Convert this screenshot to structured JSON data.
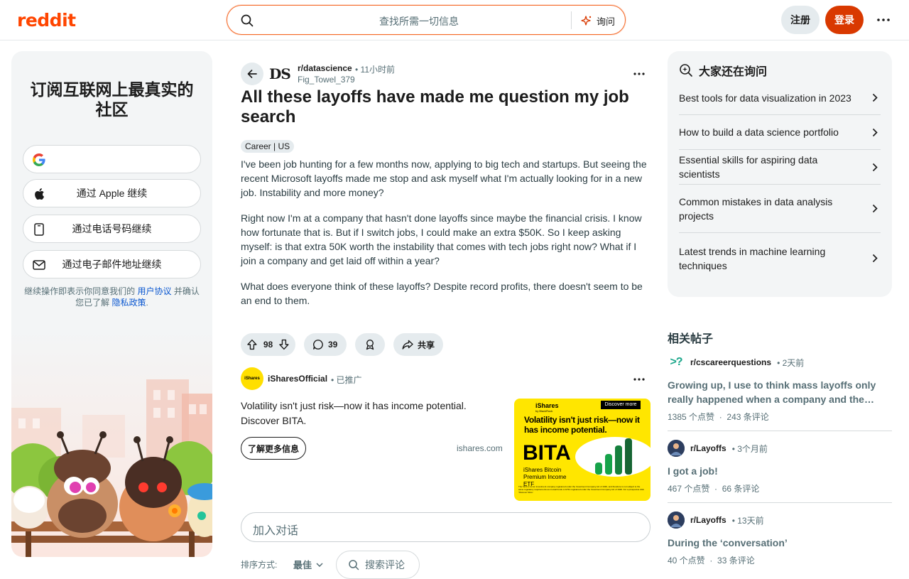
{
  "header": {
    "logo": "reddit",
    "search_placeholder": "查找所需一切信息",
    "ask_label": "询问",
    "signup_label": "注册",
    "login_label": "登录"
  },
  "left": {
    "title": "订阅互联网上最真实的社区",
    "auth_buttons": [
      {
        "label": "",
        "icon": "google-icon"
      },
      {
        "label": "通过 Apple 继续",
        "icon": "apple-icon"
      },
      {
        "label": "通过电话号码继续",
        "icon": "phone-icon"
      },
      {
        "label": "通过电子邮件地址继续",
        "icon": "mail-icon"
      }
    ],
    "terms_prefix": "继续操作即表示你同意我们的",
    "terms_link": "用户协议",
    "terms_mid": "并确认您已了解",
    "privacy_link": "隐私政策",
    "terms_suffix": "."
  },
  "post": {
    "subreddit_avatar": "DS",
    "subreddit": "r/datascience",
    "time": "11小时前",
    "author": "Fig_Towel_379",
    "title": "All these layoffs have made me question my job search",
    "flair": "Career | US",
    "paragraphs": [
      "I've been job hunting for a few months now, applying to big tech and startups. But seeing the recent Microsoft layoffs made me stop and ask myself what I'm actually looking for in a new job. Instability and more money?",
      "Right now I'm at a company that hasn't done layoffs since maybe the financial crisis. I know how fortunate that is. But if I switch jobs, I could make an extra $50K. So I keep asking myself: is that extra 50K worth the instability that comes with tech jobs right now? What if I join a company and get laid off within a year?",
      "What does everyone think of these layoffs? Despite record profits, there doesn't seem to be an end to them."
    ],
    "votes": "98",
    "comments": "39",
    "share_label": "共享"
  },
  "ad": {
    "avatar_text": "iShares",
    "name": "iSharesOfficial",
    "promoted": "已推广",
    "text": "Volatility isn't just risk—now it has income potential. Discover BITA.",
    "learn_more": "了解更多信息",
    "domain": "ishares.com",
    "image": {
      "brand": "iShares",
      "brand_sub": "by BlackRock",
      "cta": "Discover more",
      "headline": "Volatility isn't just risk—now it has income potential.",
      "ticker": "BITA",
      "fund_name": "iShares Bitcoin Premium Income ETF",
      "fineprint": "The fund is not an investment company registered under the Investment Company Act of 1940, and therefore is not subject to the same regulatory requirements as mutual funds or ETFs registered under the Investment Company Act of 1940. For a prospectus click 'Discover More'."
    }
  },
  "comments": {
    "placeholder": "加入对话",
    "sort_label": "排序方式:",
    "sort_value": "最佳",
    "search_label": "搜索评论"
  },
  "ask_card": {
    "title": "大家还在询问",
    "items": [
      "Best tools for data visualization in 2023",
      "How to build a data science portfolio",
      "Essential skills for aspiring data scientists",
      "Common mistakes in data analysis projects",
      "Latest trends in machine learning techniques"
    ]
  },
  "related": {
    "title": "相关帖子",
    "posts": [
      {
        "icon_text": ">?",
        "subreddit": "r/cscareerquestions",
        "time": "2天前",
        "title": "Growing up, I use to think mass layoffs only really happened when a company and the…",
        "upvotes": "1385 个点赞",
        "comments": "243 条评论"
      },
      {
        "icon_text": "",
        "subreddit": "r/Layoffs",
        "time": "3个月前",
        "title": "I got a job!",
        "upvotes": "467 个点赞",
        "comments": "66 条评论"
      },
      {
        "icon_text": "",
        "subreddit": "r/Layoffs",
        "time": "13天前",
        "title": "During the ‘conversation’",
        "upvotes": "40 个点赞",
        "comments": "33 条评论"
      }
    ]
  },
  "colors": {
    "brand": "#ff4500",
    "login": "#d93900",
    "link": "#0a57d0"
  }
}
